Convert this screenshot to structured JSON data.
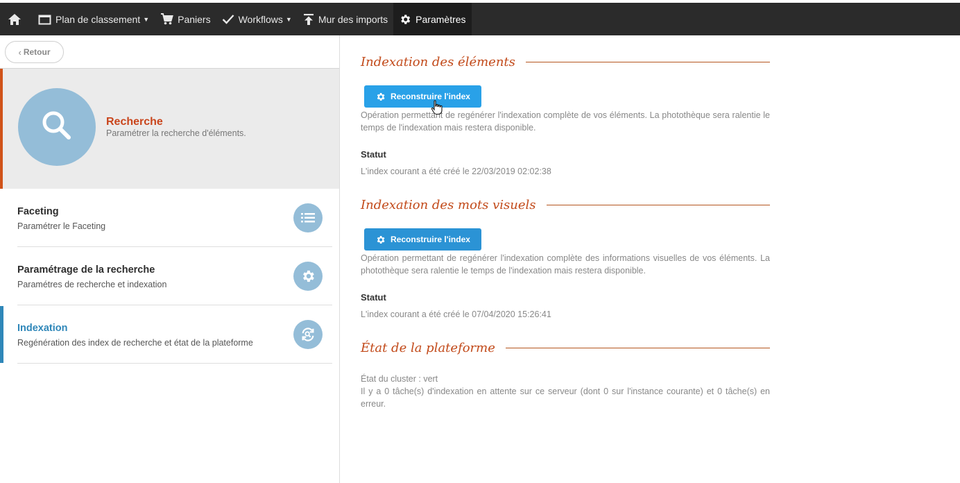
{
  "nav": {
    "home_icon": "home-icon",
    "items": [
      {
        "label": "Plan de classement",
        "icon": "folder-icon",
        "has_caret": true
      },
      {
        "label": "Paniers",
        "icon": "cart-icon",
        "has_caret": false
      },
      {
        "label": "Workflows",
        "icon": "check-icon",
        "has_caret": true
      },
      {
        "label": "Mur des imports",
        "icon": "upload-icon",
        "has_caret": false
      },
      {
        "label": "Paramètres",
        "icon": "gear-icon",
        "has_caret": false,
        "active": true
      }
    ]
  },
  "sidebar": {
    "back_label": "Retour",
    "hero": {
      "title": "Recherche",
      "subtitle": "Paramétrer la recherche d'éléments.",
      "icon": "search-icon"
    },
    "items": [
      {
        "title": "Faceting",
        "subtitle": "Paramétrer le Faceting",
        "icon": "list-icon"
      },
      {
        "title": "Paramétrage de la recherche",
        "subtitle": "Paramétres de recherche et indexation",
        "icon": "gear-icon"
      },
      {
        "title": "Indexation",
        "subtitle": "Regénération des index de recherche et état de la plateforme",
        "icon": "refresh-search-icon",
        "active": true
      }
    ]
  },
  "main": {
    "sections": [
      {
        "title": "Indexation des éléments",
        "button_label": "Reconstruire l'index",
        "description": "Opération permettant de regénérer l'indexation complète de vos éléments. La photothèque sera ralentie le temps de l'indexation mais restera disponible.",
        "status_label": "Statut",
        "status_text": "L'index courant a été créé le 22/03/2019 02:02:38"
      },
      {
        "title": "Indexation des mots visuels",
        "button_label": "Reconstruire l'index",
        "description": "Opération permettant de regénérer l'indexation complète des informations visuelles de vos éléments. La photothèque sera ralentie le temps de l'indexation mais restera disponible.",
        "status_label": "Statut",
        "status_text": "L'index courant a été créé le 07/04/2020 15:26:41"
      },
      {
        "title": "État de la plateforme",
        "cluster_status": "État du cluster : vert",
        "tasks_text": "Il y a 0 tâche(s) d'indexation en attente sur ce serveur (dont 0 sur l'instance courante) et 0 tâche(s) en erreur."
      }
    ]
  },
  "colors": {
    "topbar": "#2b2b2b",
    "accent_orange": "#c24a1a",
    "accent_blue": "#2f87b9",
    "button_blue": "#29a1e8",
    "icon_circle": "#94bdd8"
  }
}
